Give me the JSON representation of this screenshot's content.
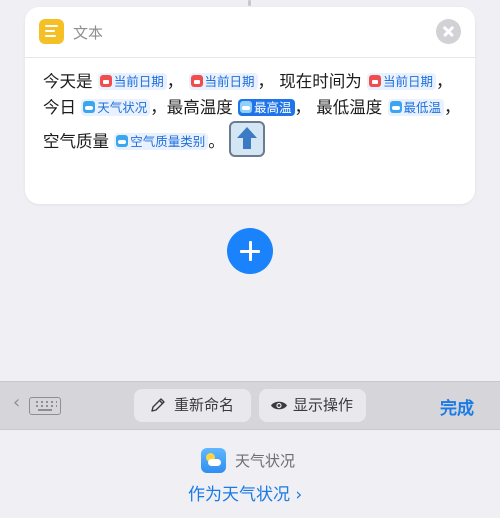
{
  "card": {
    "title": "文本",
    "app_icon": "text-document-icon",
    "close_icon": "close-icon",
    "content": {
      "t1": "今天是 ",
      "tok1": "当前日期",
      "t2": "， ",
      "tok2": "当前日期",
      "t3": "， 现在时间为",
      "tok3": "当前日期",
      "t4": "，今日 ",
      "tok4": "天气状况",
      "t5": "，最高温度 ",
      "tok5": "最高温",
      "t6": "， 最低温度 ",
      "tok6": "最低温",
      "t7": "，空气质量 ",
      "tok7": "空气质量类别",
      "t8": "。"
    }
  },
  "add_button_icon": "plus-icon",
  "toolbar": {
    "keyboard_icon": "keyboard-icon",
    "rename_label": "重新命名",
    "show_actions_label": "显示操作",
    "done_label": "完成"
  },
  "bottom": {
    "app_name": "天气状况",
    "link_label": "作为天气状况 ›"
  },
  "colors": {
    "accent": "#1a7ae6",
    "background": "#efeff4",
    "token_selected": "#1f74e8",
    "calendar_icon": "#f04e4e",
    "weather_icon": "#3aa5f0"
  }
}
